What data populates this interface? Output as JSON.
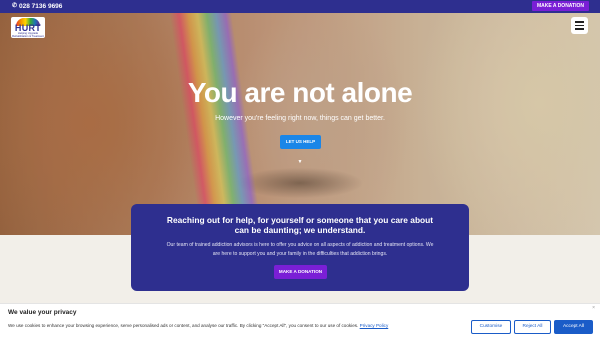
{
  "topbar": {
    "phone": "028 7136 9696",
    "donate_label": "MAKE A DONATION"
  },
  "logo": {
    "name": "HURT",
    "tagline": "Helping Upgrade Rehabilitation & Treatment"
  },
  "hero": {
    "headline": "You are not alone",
    "subheadline": "However you're feeling right now, things can get better.",
    "cta_label": "LET US HELP",
    "scroll_icon": "chevron-down-icon"
  },
  "card": {
    "title": "Reaching out for help, for yourself or someone that you care about can be daunting; we understand.",
    "body": "Our team of trained addiction advisors is here to offer you advice on all aspects of addiction and treatment options. We are here to support you and your family in the difficulties that addiction brings.",
    "donate_label": "MAKE A DONATION"
  },
  "cookie": {
    "title": "We value your privacy",
    "text": "We use cookies to enhance your browsing experience, serve personalised ads or content, and analyse our traffic. By clicking \"Accept All\", you consent to our use of cookies.",
    "link_label": "Privacy Policy",
    "close_label": "×",
    "customise_label": "Customise",
    "reject_label": "Reject All",
    "accept_label": "Accept All"
  },
  "colors": {
    "brand_navy": "#2e2f8f",
    "donate_purple": "#7a1fd6",
    "cta_blue": "#1a86e8",
    "cookie_blue": "#1a5cc8"
  }
}
